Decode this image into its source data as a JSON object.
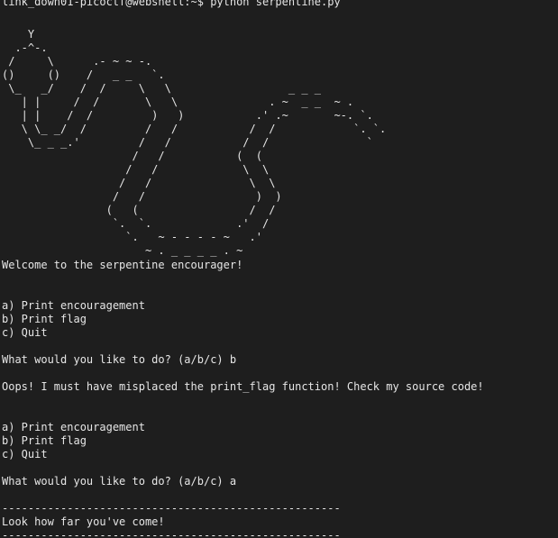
{
  "terminal": {
    "prompt_line": "link_down01-picoctf@webshell:~$ python serpentine.py",
    "ascii_art": "    Y\n  .-^-.\n /     \\      .- ~ ~ -.\n()     ()    /   _ _   `.\n \\_   _/    /  /     \\   \\                  _ _ _\n   | |     /  /       \\   \\              . ~  _ _  ~ .\n   | |    /  /         )   )           .' .~       ~-. `.\n   \\ \\_ _/  /         /   /           /  /            `. `.\n    \\_ _ _.'         /   /           /  /               `\n                    /   /           (  (\n                   /   /             \\  \\\n                  /   /               \\  \\\n                 /   /                 )  )\n                (   (                 /  /\n                 `.  `.             .'  /\n                   `.   ~ - - - - ~   .'\n                      ~ . _ _ _ _ . ~",
    "welcome": "Welcome to the serpentine encourager!",
    "menu_a_1": "a) Print encouragement",
    "menu_b_1": "b) Print flag",
    "menu_c_1": "c) Quit",
    "prompt_1": "What would you like to do? (a/b/c) b",
    "oops": "Oops! I must have misplaced the print_flag function! Check my source code!",
    "menu_a_2": "a) Print encouragement",
    "menu_b_2": "b) Print flag",
    "menu_c_2": "c) Quit",
    "prompt_2": "What would you like to do? (a/b/c) a",
    "divider_1": "----------------------------------------------------",
    "encouragement": "Look how far you've come!",
    "divider_2": "----------------------------------------------------"
  }
}
